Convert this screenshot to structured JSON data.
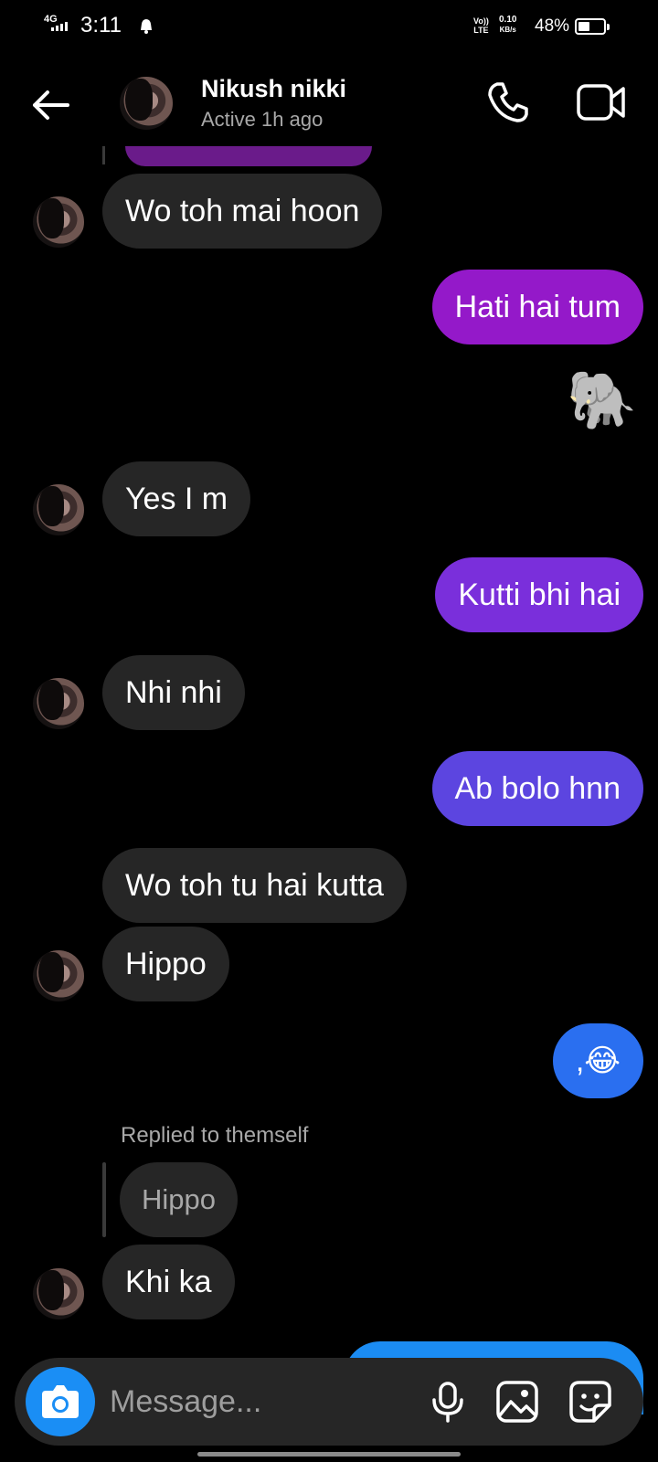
{
  "status_bar": {
    "network": "4G",
    "time": "3:11",
    "volte": "Vo)) LTE",
    "speed_value": "0.10",
    "speed_unit": "KB/s",
    "battery": "48%",
    "battery_level": 0.48
  },
  "header": {
    "name": "Nikush nikki",
    "status": "Active 1h ago",
    "icons": [
      "back-arrow-icon",
      "phone-icon",
      "video-camera-icon"
    ]
  },
  "messages": [
    {
      "from": "them",
      "text": "Wo toh mai hoon"
    },
    {
      "from": "me",
      "text": "Hati hai tum",
      "color": "#9419c9"
    },
    {
      "from": "me",
      "text": "🐘",
      "type": "emoji"
    },
    {
      "from": "them",
      "text": "Yes I m"
    },
    {
      "from": "me",
      "text": "Kutti bhi hai",
      "color": "#7a2fdb"
    },
    {
      "from": "them",
      "text": "Nhi nhi"
    },
    {
      "from": "me",
      "text": "Ab bolo hnn",
      "color": "#5c45e0"
    },
    {
      "from": "them",
      "text": "Wo toh tu hai kutta"
    },
    {
      "from": "them",
      "text": "Hippo"
    },
    {
      "from": "me",
      "text": ",😂",
      "color": "#2a6ff0"
    },
    {
      "from": "them",
      "reply_label": "Replied to themself",
      "quoted": "Hippo",
      "text": "Khi ka"
    }
  ],
  "composer": {
    "placeholder": "Message...",
    "icons": [
      "camera-icon",
      "microphone-icon",
      "gallery-icon",
      "sticker-icon"
    ],
    "accent": "#1a8ef5"
  },
  "colors": {
    "background": "#000000",
    "incoming_bubble": "#262626"
  }
}
